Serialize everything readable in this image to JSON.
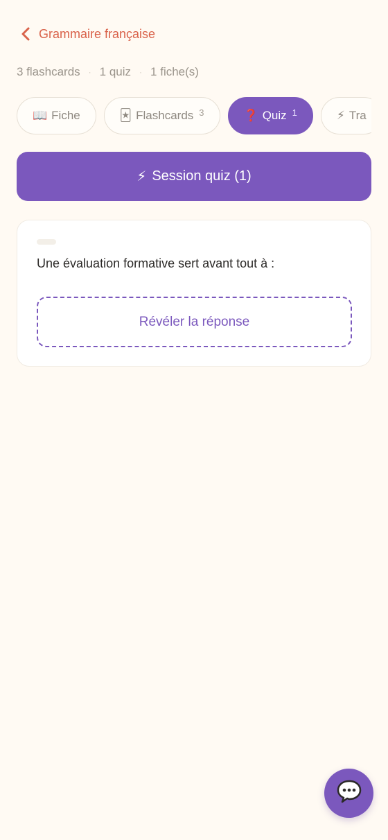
{
  "header": {
    "back_label": "Grammaire française"
  },
  "stats": {
    "flashcards": "3 flashcards",
    "separator": "·",
    "quiz": "1 quiz",
    "fiches": "1 fiche(s)"
  },
  "tabs": [
    {
      "emoji": "📖",
      "label": "Fiche",
      "count": ""
    },
    {
      "emoji": "🃏",
      "label": "Flashcards",
      "count": "3"
    },
    {
      "emoji": "❓",
      "label": "Quiz",
      "count": "1",
      "active": true
    },
    {
      "emoji": "⚡",
      "label": "Tra",
      "count": ""
    }
  ],
  "session": {
    "emoji": "⚡",
    "label": "Session quiz (1)"
  },
  "card": {
    "question": "Une évaluation formative sert avant tout à :",
    "reveal_label": "Révéler la réponse"
  },
  "chat": {
    "icon": "chat-bubble-icon"
  },
  "colors": {
    "accent": "#7b58bd",
    "back_link": "#d9624a",
    "background": "#fffaf3"
  }
}
